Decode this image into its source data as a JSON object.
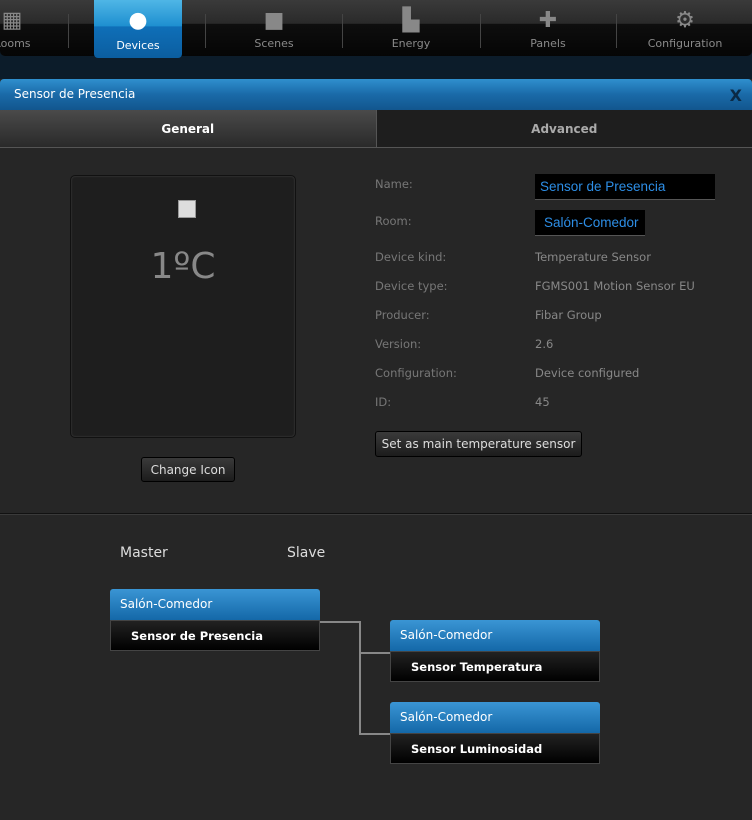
{
  "nav": {
    "tabs": [
      {
        "label": "Rooms",
        "icon": "rooms-icon"
      },
      {
        "label": "Devices",
        "icon": "bulb-icon",
        "active": true
      },
      {
        "label": "Scenes",
        "icon": "clapperboard-icon"
      },
      {
        "label": "Energy",
        "icon": "bar-chart-icon"
      },
      {
        "label": "Panels",
        "icon": "puzzle-icon"
      },
      {
        "label": "Configuration",
        "icon": "gears-icon"
      }
    ]
  },
  "dialog": {
    "title": "Sensor de Presencia",
    "close": "X",
    "tabs": {
      "general": "General",
      "advanced": "Advanced"
    },
    "icon_value": "1ºC",
    "change_icon": "Change Icon",
    "fields": {
      "name_label": "Name:",
      "name_value": "Sensor de Presencia",
      "room_label": "Room:",
      "room_value": "Salón-Comedor",
      "rows": [
        {
          "label": "Device kind:",
          "value": "Temperature Sensor"
        },
        {
          "label": "Device type:",
          "value": "FGMS001 Motion Sensor EU"
        },
        {
          "label": "Producer:",
          "value": "Fibar Group"
        },
        {
          "label": "Version:",
          "value": "2.6"
        },
        {
          "label": "Configuration:",
          "value": "Device configured"
        },
        {
          "label": "ID:",
          "value": "45"
        }
      ]
    },
    "set_main": "Set as main temperature sensor",
    "association": {
      "master_label": "Master",
      "slave_label": "Slave",
      "master": {
        "room": "Salón-Comedor",
        "device": "Sensor de Presencia"
      },
      "slaves": [
        {
          "room": "Salón-Comedor",
          "device": "Sensor Temperatura"
        },
        {
          "room": "Salón-Comedor",
          "device": "Sensor Luminosidad"
        }
      ]
    }
  }
}
